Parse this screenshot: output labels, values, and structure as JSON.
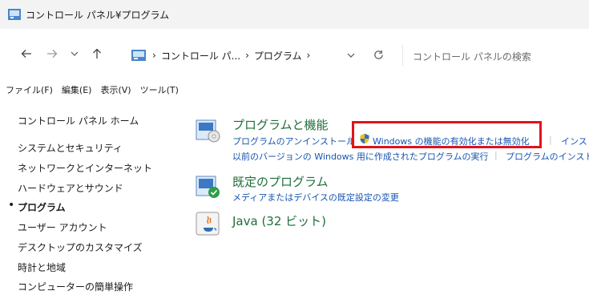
{
  "window": {
    "title": "コントロール パネル¥プログラム"
  },
  "nav": {
    "breadcrumbs": [
      "コントロール パ...",
      "プログラム"
    ],
    "search_placeholder": "コントロール パネルの検索"
  },
  "menu": [
    "ファイル(F)",
    "編集(E)",
    "表示(V)",
    "ツール(T)"
  ],
  "sidebar": {
    "items": [
      "コントロール パネル ホーム",
      "システムとセキュリティ",
      "ネットワークとインターネット",
      "ハードウェアとサウンド",
      "プログラム",
      "ユーザー アカウント",
      "デスクトップのカスタマイズ",
      "時計と地域",
      "コンピューターの簡単操作"
    ],
    "current": "プログラム"
  },
  "categories": {
    "programs_features": {
      "title": "プログラムと機能",
      "link_uninstall": "プログラムのアンインストール",
      "link_windows_features": "Windows の機能の有効化または無効化",
      "link_install_partial": "インスト",
      "link_older_versions": "以前のバージョンの Windows 用に作成されたプログラムの実行",
      "link_install_method_partial": "プログラムのインストー"
    },
    "default_programs": {
      "title": "既定のプログラム",
      "link_media_defaults": "メディアまたはデバイスの既定設定の変更"
    },
    "java": {
      "title": "Java (32 ビット)"
    }
  },
  "colors": {
    "link": "#1654b0",
    "category_title": "#1e6e3a",
    "highlight": "#e0131c"
  }
}
